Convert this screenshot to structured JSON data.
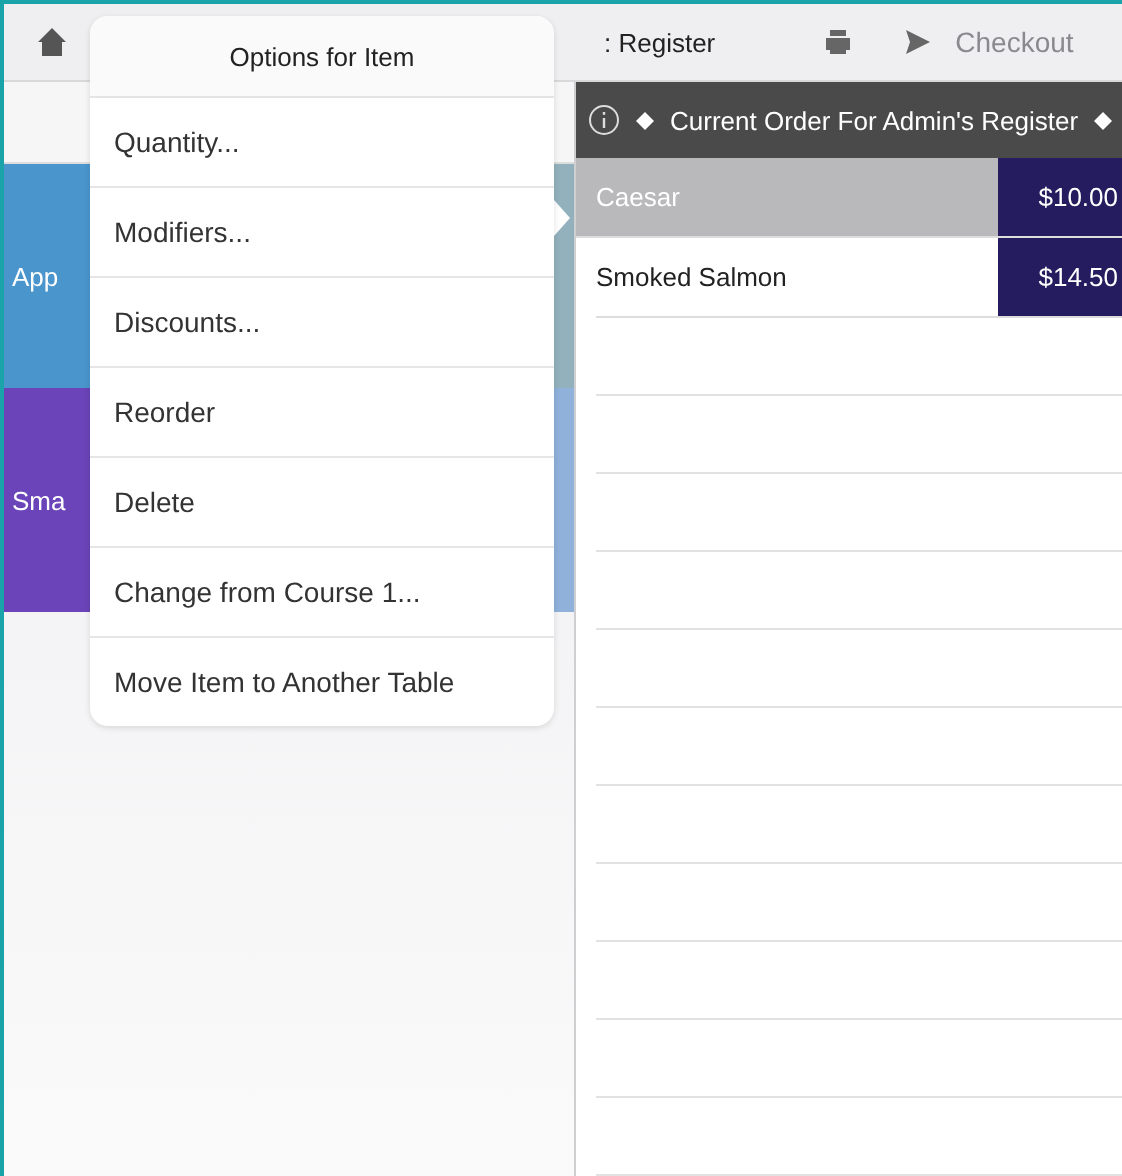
{
  "top_bar": {
    "title": ": Register",
    "checkout": "Checkout"
  },
  "categories": [
    {
      "label": "App",
      "color": "#4a95cc"
    },
    {
      "color": "#93b1bd"
    },
    {
      "label": "Sma",
      "color": "#6a44b8"
    },
    {
      "color": "#8fb1da"
    }
  ],
  "order": {
    "title": "Current Order For Admin's Register",
    "items": [
      {
        "name": "Caesar",
        "price": "$10.00",
        "selected": true
      },
      {
        "name": "Smoked Salmon",
        "price": "$14.50",
        "selected": false
      }
    ]
  },
  "popover": {
    "title": "Options for Item",
    "options": [
      "Quantity...",
      "Modifiers...",
      "Discounts...",
      "Reorder",
      "Delete",
      "Change from Course 1...",
      "Move Item to Another Table"
    ]
  }
}
